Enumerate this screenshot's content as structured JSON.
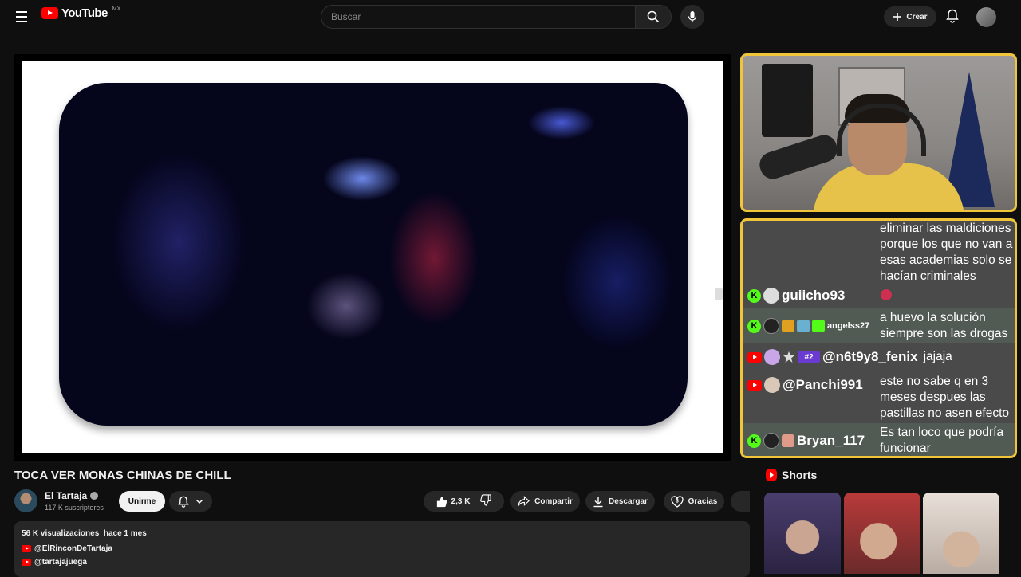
{
  "header": {
    "logo_text": "YouTube",
    "region": "MX",
    "search_placeholder": "Buscar",
    "create_label": "Crear"
  },
  "video": {
    "title": "TOCA VER MONAS CHINAS DE CHILL",
    "channel_name": "El Tartaja",
    "subscribers": "117 K suscriptores",
    "join_label": "Unirme",
    "likes": "2,3 K",
    "share_label": "Compartir",
    "download_label": "Descargar",
    "thanks_label": "Gracias",
    "views": "56 K visualizaciones",
    "age": "hace 1 mes",
    "links": [
      "@ElRinconDeTartaja",
      "@tartajajuega"
    ]
  },
  "chat": {
    "messages": [
      {
        "platform": "",
        "user": "",
        "text": "eliminar las maldiciones porque los que no van a esas academias solo se hacían criminales"
      },
      {
        "platform": "kick",
        "user": "guiicho93",
        "text": ""
      },
      {
        "platform": "kick",
        "user": "angelss27",
        "text": "a huevo la solución siempre son las drogas"
      },
      {
        "platform": "youtube",
        "user": "@n6t9y8_fenix",
        "text": "jajaja"
      },
      {
        "platform": "youtube",
        "user": "@Panchi991",
        "text": "este no sabe q en 3 meses despues las pastillas no asen efecto"
      },
      {
        "platform": "kick",
        "user": "Bryan_117",
        "text": "Es tan loco que podría funcionar"
      }
    ],
    "badge_text": "#2"
  },
  "shorts": {
    "title": "Shorts"
  },
  "colors": {
    "accent_yellow": "#f0c53a",
    "youtube_red": "#ff0000",
    "kick_green": "#53fc18",
    "background": "#0f0f0f"
  },
  "icons": [
    "menu-icon",
    "search-icon",
    "mic-icon",
    "plus-icon",
    "bell-icon",
    "like-icon",
    "dislike-icon",
    "share-icon",
    "download-icon",
    "heart-icon"
  ]
}
